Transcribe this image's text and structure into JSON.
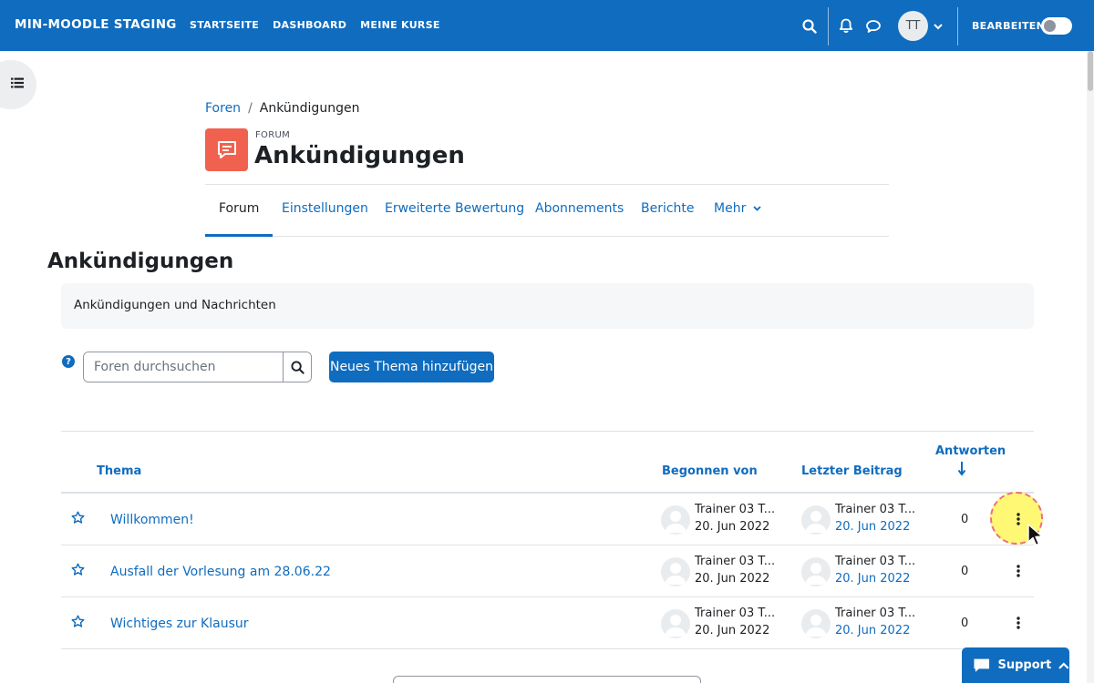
{
  "navbar": {
    "brand": "MIN-MOODLE STAGING",
    "links": [
      "STARTSEITE",
      "DASHBOARD",
      "MEINE KURSE"
    ],
    "user_initials": "TT",
    "edit_mode_label": "BEARBEITEN",
    "edit_mode_on": false,
    "color": "#0f6cbf"
  },
  "breadcrumb": {
    "parent": "Foren",
    "separator": "/",
    "current": "Ankündigungen"
  },
  "header": {
    "pre_title": "FORUM",
    "title": "Ankündigungen",
    "icon": "forum-icon",
    "icon_color": "#f0624f"
  },
  "secondary_nav": {
    "tabs": [
      "Forum",
      "Einstellungen",
      "Erweiterte Bewertung",
      "Abonnements",
      "Berichte",
      "Mehr"
    ],
    "active": "Forum"
  },
  "main": {
    "heading": "Ankündigungen",
    "intro": "Ankündigungen und Nachrichten",
    "search_placeholder": "Foren durchsuchen",
    "add_button": "Neues Thema hinzufügen"
  },
  "table": {
    "columns": {
      "topic": "Thema",
      "started_by": "Begonnen von",
      "last_post": "Letzter Beitrag",
      "replies": "Antworten"
    },
    "sort_column": "replies",
    "sort_direction": "descending",
    "rows": [
      {
        "topic": "Willkommen!",
        "started_by": "Trainer 03 T...",
        "started_date": "20. Jun 2022",
        "last_post_by": "Trainer 03 T...",
        "last_post_date": "20. Jun 2022",
        "replies": "0"
      },
      {
        "topic": "Ausfall der Vorlesung am 28.06.22",
        "started_by": "Trainer 03 T...",
        "started_date": "20. Jun 2022",
        "last_post_by": "Trainer 03 T...",
        "last_post_date": "20. Jun 2022",
        "replies": "0"
      },
      {
        "topic": "Wichtiges zur Klausur",
        "started_by": "Trainer 03 T...",
        "started_date": "20. Jun 2022",
        "last_post_by": "Trainer 03 T...",
        "last_post_date": "20. Jun 2022",
        "replies": "0"
      }
    ]
  },
  "support": {
    "label": "Support"
  }
}
